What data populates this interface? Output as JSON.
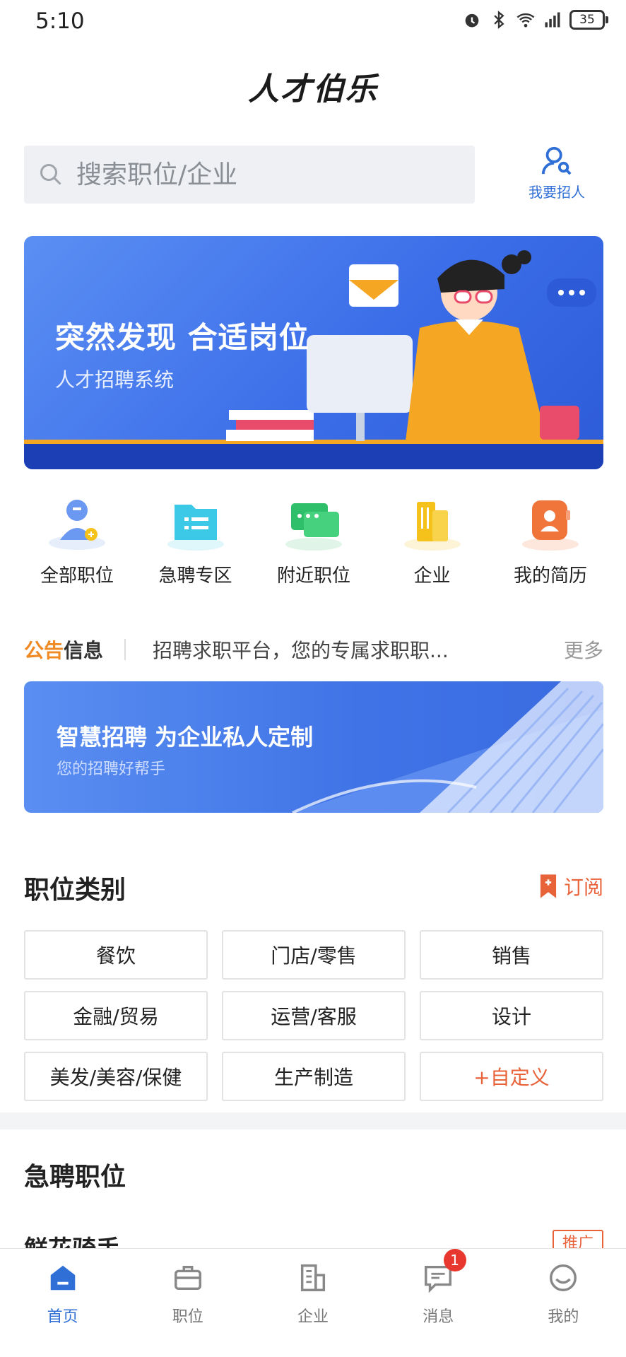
{
  "status_bar": {
    "time": "5:10",
    "battery": "35"
  },
  "app": {
    "title": "人才伯乐"
  },
  "search": {
    "placeholder": "搜索职位/企业"
  },
  "recruit": {
    "label": "我要招人"
  },
  "banner": {
    "title": "突然发现 合适岗位",
    "subtitle": "人才招聘系统"
  },
  "quick_menu": [
    {
      "label": "全部职位",
      "icon": "person-icon",
      "color": "#6b98f0"
    },
    {
      "label": "急聘专区",
      "icon": "folder-icon",
      "color": "#3cc9e8"
    },
    {
      "label": "附近职位",
      "icon": "chat-icon",
      "color": "#2fbf6a"
    },
    {
      "label": "企业",
      "icon": "building-icon",
      "color": "#f5c21b"
    },
    {
      "label": "我的简历",
      "icon": "resume-icon",
      "color": "#f0753b"
    }
  ],
  "notice": {
    "tag_part1": "公告",
    "tag_part2": "信息",
    "text": "招聘求职平台，您的专属求职职...",
    "more": "更多"
  },
  "banner2": {
    "title": "智慧招聘 为企业私人定制",
    "subtitle": "您的招聘好帮手"
  },
  "categories": {
    "title": "职位类别",
    "subscribe": "订阅",
    "items": [
      "餐饮",
      "门店/零售",
      "销售",
      "金融/贸易",
      "运营/客服",
      "设计",
      "美发/美容/保健",
      "生产制造",
      "+自定义"
    ]
  },
  "urgent": {
    "title": "急聘职位",
    "first_job": "鲜花骑手",
    "tag": "推广"
  },
  "bottom_nav": {
    "items": [
      {
        "label": "首页",
        "icon": "home-icon"
      },
      {
        "label": "职位",
        "icon": "briefcase-icon"
      },
      {
        "label": "企业",
        "icon": "building-icon"
      },
      {
        "label": "消息",
        "icon": "message-icon",
        "badge": "1"
      },
      {
        "label": "我的",
        "icon": "profile-icon"
      }
    ]
  },
  "colors": {
    "primary": "#2f6fd6",
    "accent": "#e8623a",
    "badge": "#e8372e"
  }
}
